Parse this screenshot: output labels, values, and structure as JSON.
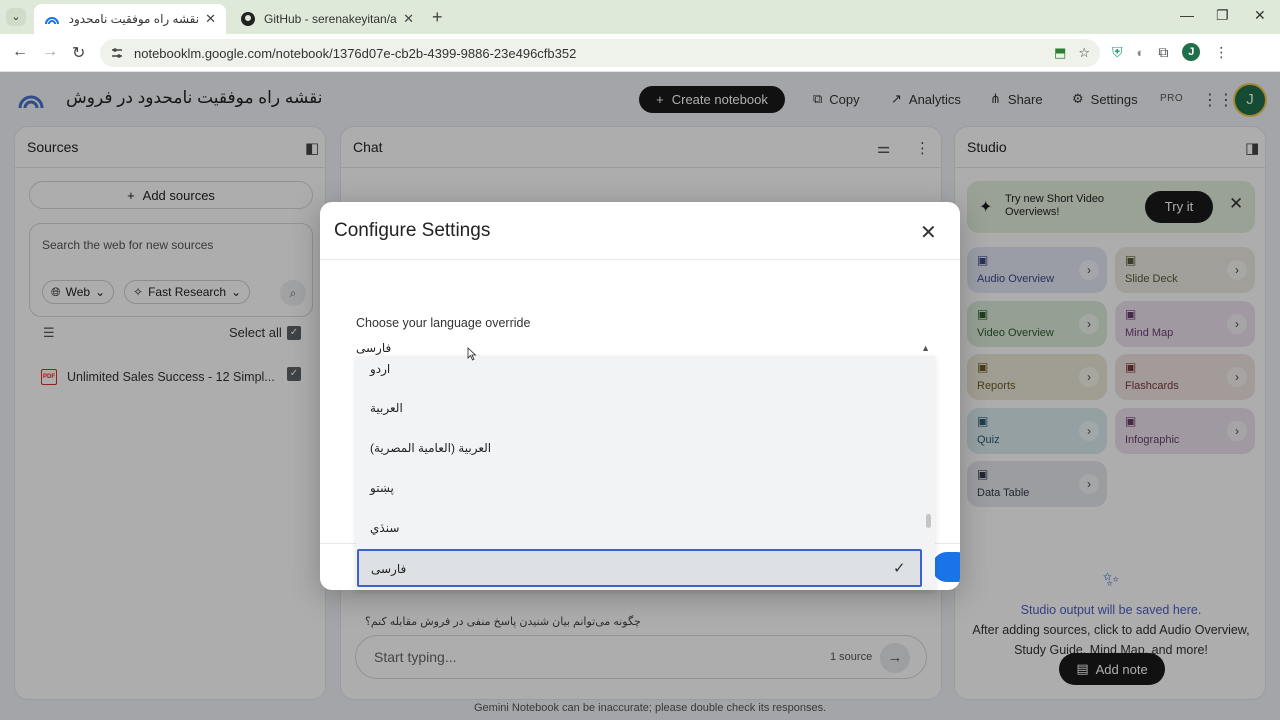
{
  "browser": {
    "tabs": [
      {
        "title": "نقشه راه موفقیت نامحدود در فروش",
        "active": true
      },
      {
        "title": "GitHub - serenakeyitan/awesome",
        "active": false
      }
    ],
    "url": "notebooklm.google.com/notebook/1376d07e-cb2b-4399-9886-23e496cfb352",
    "profile_initial": "J"
  },
  "header": {
    "notebook_title": "نقشه راه موفقیت نامحدود در فروش",
    "create_label": "Create notebook",
    "copy_label": "Copy",
    "analytics_label": "Analytics",
    "share_label": "Share",
    "settings_label": "Settings",
    "pro_label": "PRO",
    "user_initial": "J"
  },
  "sources": {
    "title": "Sources",
    "add_label": "Add sources",
    "search_placeholder": "Search the web for new sources",
    "web_chip": "Web",
    "research_chip": "Fast Research",
    "select_all": "Select all",
    "items": [
      {
        "name": "Unlimited Sales Success - 12 Simpl..."
      }
    ]
  },
  "chat": {
    "title": "Chat",
    "suggestion": "چگونه می‌توانم بیان شنیدن پاسخ منفی در فروش مقابله کنم؟",
    "input_placeholder": "Start typing...",
    "source_count": "1 source",
    "disclaimer": "Gemini Notebook can be inaccurate; please double check its responses."
  },
  "studio": {
    "title": "Studio",
    "banner_text": "Try new Short Video Overviews!",
    "try_label": "Try it",
    "tiles": [
      {
        "label": "Audio Overview",
        "icon": "waveform-icon",
        "color": "#e3e8f5",
        "text_color": "#3b4a8a"
      },
      {
        "label": "Slide Deck",
        "icon": "slides-icon",
        "color": "#ecebe2",
        "text_color": "#5a5a3a"
      },
      {
        "label": "Video Overview",
        "icon": "video-icon",
        "color": "#dcecdb",
        "text_color": "#2f5a2f"
      },
      {
        "label": "Mind Map",
        "icon": "mindmap-icon",
        "color": "#ece2ee",
        "text_color": "#6a3d72"
      },
      {
        "label": "Reports",
        "icon": "report-icon",
        "color": "#ece9d8",
        "text_color": "#6a5a2a"
      },
      {
        "label": "Flashcards",
        "icon": "flashcards-icon",
        "color": "#f1e3e3",
        "text_color": "#7a3a3a"
      },
      {
        "label": "Quiz",
        "icon": "quiz-icon",
        "color": "#dcecf0",
        "text_color": "#2a5a70"
      },
      {
        "label": "Infographic",
        "icon": "infographic-icon",
        "color": "#eee2ed",
        "text_color": "#6a3d6a"
      },
      {
        "label": "Data Table",
        "icon": "table-icon",
        "color": "#e5e8ee",
        "text_color": "#333a4a"
      }
    ],
    "empty_title": "Studio output will be saved here.",
    "empty_body_1": "After adding sources, click to add Audio Overview,",
    "empty_body_2": "Study Guide, Mind Map, and more!",
    "add_note_label": "Add note"
  },
  "modal": {
    "title": "Configure Settings",
    "language_label": "Choose your language override",
    "selected_language": "فارسی",
    "options": [
      "اردو",
      "العربية",
      "العربية (العامية المصرية)",
      "پښتو",
      "سنڌي",
      "فارسی"
    ],
    "selected_index": 5
  },
  "colors": {
    "accent": "#1a73e8",
    "dark_button": "#1a1a1a",
    "selection_border": "#3b63d0"
  }
}
